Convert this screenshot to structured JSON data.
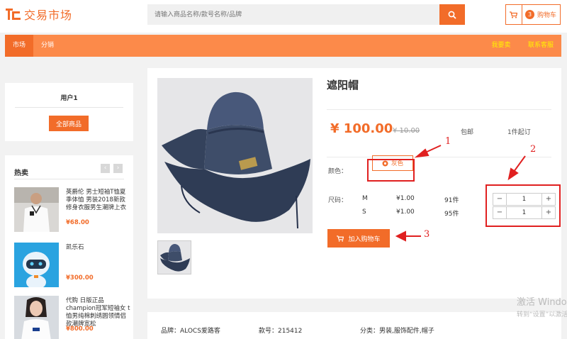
{
  "brand": {
    "name": "交易市场"
  },
  "search": {
    "placeholder": "请输入商品名称/款号名称/品牌"
  },
  "cart": {
    "count": "3",
    "label": "购物车"
  },
  "nav": {
    "items": [
      {
        "label": "市场",
        "active": true
      },
      {
        "label": "分销",
        "active": false
      }
    ],
    "right": [
      {
        "label": "我要卖"
      },
      {
        "label": "联系客服"
      }
    ]
  },
  "user": {
    "name": "用户1",
    "all_products_label": "全部商品"
  },
  "hot": {
    "title": "热卖",
    "prev_icon": "‹",
    "next_icon": "›",
    "items": [
      {
        "name": "英爵伦 男士短袖T恤夏季体恤 男装2018新款修身衣服男生潮牌上衣",
        "price": "¥68.00"
      },
      {
        "name": "凯乐石",
        "price": "¥300.00"
      },
      {
        "name": "代购 日版正品champion冠军短袖女 t恤男纯棉刺绣圆领情侣款潮牌宽松",
        "price": "¥800.00"
      }
    ]
  },
  "product": {
    "title": "遮阳帽",
    "price": "¥ 100.00",
    "original_price": "¥ 10.00",
    "shipping": "包邮",
    "min_order": "1件起订",
    "color_label": "颜色：",
    "color_option": "灰色",
    "size_label": "尺码：",
    "sizes": [
      {
        "name": "M",
        "price": "¥1.00",
        "stock": "91件",
        "qty": "1"
      },
      {
        "name": "S",
        "price": "¥1.00",
        "stock": "95件",
        "qty": "1"
      }
    ],
    "minus": "−",
    "plus": "+",
    "add_to_cart": "加入购物车"
  },
  "annotations": [
    "1",
    "2",
    "3"
  ],
  "attributes": {
    "brand": "品牌：ALOCS爱路客",
    "style_no": "款号：215412",
    "category": "分类：男装,服饰配件,帽子"
  },
  "watermark": {
    "line1": "激活 Windows",
    "line2": "转到“设置”以激活"
  },
  "colors": {
    "accent": "#f26c29",
    "nav_bg": "#fc8a4a",
    "annotation": "#e02020"
  }
}
